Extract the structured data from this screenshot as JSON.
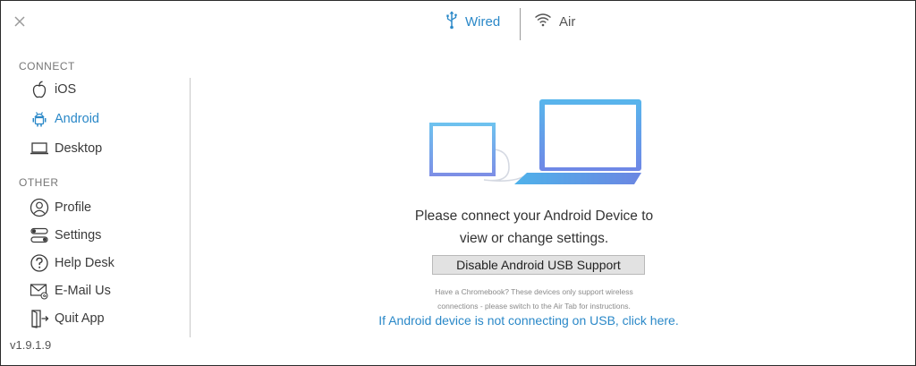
{
  "tabs": {
    "wired": {
      "label": "Wired",
      "icon": "usb-icon"
    },
    "air": {
      "label": "Air",
      "icon": "wifi-icon"
    }
  },
  "sidebar": {
    "connect_title": "CONNECT",
    "connect_items": [
      {
        "label": "iOS",
        "icon": "apple-icon"
      },
      {
        "label": "Android",
        "icon": "android-icon",
        "active": true
      },
      {
        "label": "Desktop",
        "icon": "laptop-icon"
      }
    ],
    "other_title": "OTHER",
    "other_items": [
      {
        "label": "Profile",
        "icon": "user-icon"
      },
      {
        "label": "Settings",
        "icon": "toggles-icon"
      },
      {
        "label": "Help Desk",
        "icon": "help-icon"
      },
      {
        "label": "E-Mail Us",
        "icon": "mail-icon"
      },
      {
        "label": "Quit App",
        "icon": "exit-icon"
      }
    ],
    "version": "v1.9.1.9"
  },
  "main": {
    "message_line1": "Please connect your Android Device to",
    "message_line2": "view or change settings.",
    "disable_button": "Disable Android USB Support",
    "note_line1": "Have a Chromebook? These devices only support wireless",
    "note_line2": "connections - please switch to the Air Tab for instructions.",
    "usb_link": "If Android device is not connecting on USB, click here."
  },
  "colors": {
    "accent": "#2a88c8",
    "text": "#333333",
    "muted": "#777777",
    "button_bg": "#e2e2e2"
  }
}
